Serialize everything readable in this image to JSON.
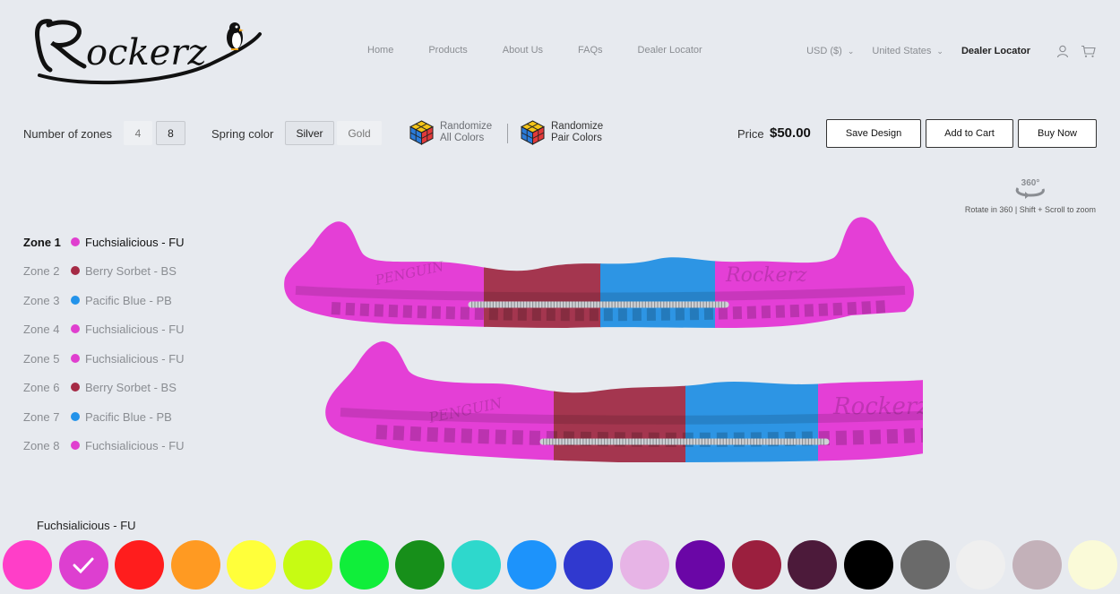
{
  "brand": {
    "name": "Rockerz",
    "logo_icon": "penguin-icon"
  },
  "nav": [
    "Home",
    "Products",
    "About Us",
    "FAQs",
    "Dealer Locator"
  ],
  "header_right": {
    "currency": "USD ($)",
    "country": "United States",
    "dealer_link": "Dealer Locator",
    "account_icon": "user-icon",
    "cart_icon": "cart-icon"
  },
  "config": {
    "zones_label": "Number of zones",
    "zone_options": [
      "4",
      "8"
    ],
    "zones_selected": "8",
    "spring_label": "Spring color",
    "spring_options": [
      "Silver",
      "Gold"
    ],
    "spring_selected": "Silver",
    "randomize_all": [
      "Randomize",
      "All Colors"
    ],
    "randomize_pair": [
      "Randomize",
      "Pair Colors"
    ]
  },
  "price": {
    "label": "Price",
    "value": "$50.00"
  },
  "actions": {
    "save": "Save Design",
    "add_to_cart": "Add to Cart",
    "buy_now": "Buy Now"
  },
  "rotate": {
    "badge": "360°",
    "hint": "Rotate in 360 | Shift + Scroll to zoom"
  },
  "zones": [
    {
      "label": "Zone 1",
      "color_name": "Fuchsialicious - FU",
      "color": "#e03fcf",
      "active": true
    },
    {
      "label": "Zone 2",
      "color_name": "Berry Sorbet - BS",
      "color": "#a52a45",
      "active": false
    },
    {
      "label": "Zone 3",
      "color_name": "Pacific Blue - PB",
      "color": "#2393ea",
      "active": false
    },
    {
      "label": "Zone 4",
      "color_name": "Fuchsialicious - FU",
      "color": "#e03fcf",
      "active": false
    },
    {
      "label": "Zone 5",
      "color_name": "Fuchsialicious - FU",
      "color": "#e03fcf",
      "active": false
    },
    {
      "label": "Zone 6",
      "color_name": "Berry Sorbet - BS",
      "color": "#a52a45",
      "active": false
    },
    {
      "label": "Zone 7",
      "color_name": "Pacific Blue - PB",
      "color": "#2393ea",
      "active": false
    },
    {
      "label": "Zone 8",
      "color_name": "Fuchsialicious - FU",
      "color": "#e03fcf",
      "active": false
    }
  ],
  "guard_text": {
    "left": "PENGUIN",
    "right": "Rockerz"
  },
  "swatch_title": "Fuchsialicious - FU",
  "swatches": [
    {
      "color": "#ff3ec8",
      "selected": false
    },
    {
      "color": "#dd3fd0",
      "selected": true
    },
    {
      "color": "#ff1d1d",
      "selected": false
    },
    {
      "color": "#ff9a22",
      "selected": false
    },
    {
      "color": "#ffff3a",
      "selected": false
    },
    {
      "color": "#c7fb13",
      "selected": false
    },
    {
      "color": "#10ee3a",
      "selected": false
    },
    {
      "color": "#178f1a",
      "selected": false
    },
    {
      "color": "#2ed8cc",
      "selected": false
    },
    {
      "color": "#1d93fb",
      "selected": false
    },
    {
      "color": "#3039cf",
      "selected": false
    },
    {
      "color": "#e7b4e6",
      "selected": false
    },
    {
      "color": "#6a06a6",
      "selected": false
    },
    {
      "color": "#9b1f3e",
      "selected": false
    },
    {
      "color": "#4c1a3a",
      "selected": false
    },
    {
      "color": "#000000",
      "selected": false
    },
    {
      "color": "#6a6a6a",
      "selected": false
    },
    {
      "color": "#efefef",
      "selected": false
    },
    {
      "color": "#c3b1b9",
      "selected": false
    },
    {
      "color": "#fafad8",
      "selected": false
    }
  ]
}
